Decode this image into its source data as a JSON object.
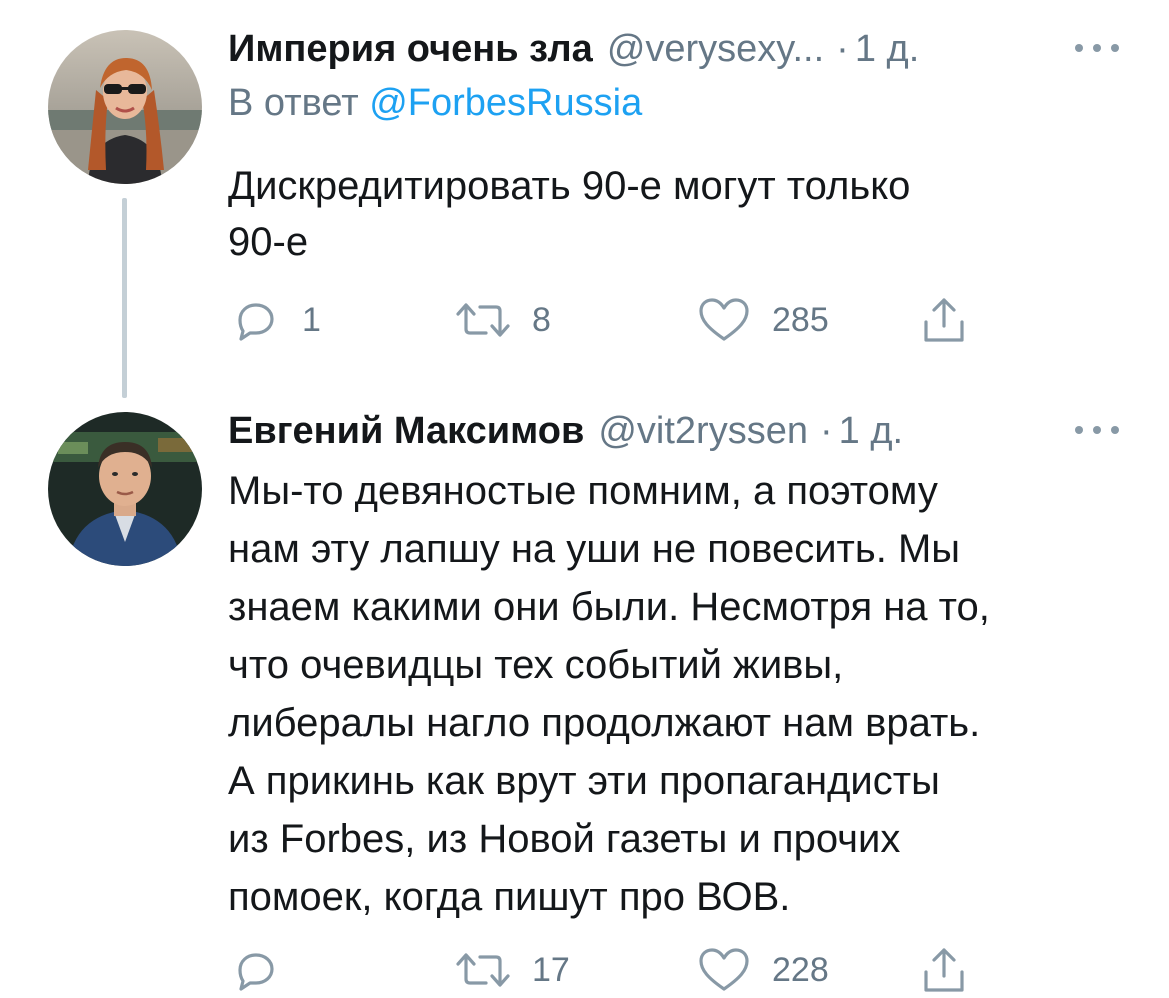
{
  "thread": [
    {
      "author": {
        "name": "Империя очень зла",
        "handle": "@verysexy...",
        "separator": "·",
        "time": "1 д."
      },
      "reply_to": {
        "prefix": "В ответ",
        "mention": "@ForbesRussia"
      },
      "text_lines": [
        "Дискредитировать 90-е могут только",
        "90-е"
      ],
      "counts": {
        "replies": "1",
        "retweets": "8",
        "likes": "285"
      },
      "icons": [
        "reply-icon",
        "retweet-icon",
        "like-icon",
        "share-icon",
        "more-icon"
      ]
    },
    {
      "author": {
        "name": "Евгений Максимов",
        "handle": "@vit2ryssen",
        "separator": "·",
        "time": "1 д."
      },
      "text_lines": [
        "Мы-то девяностые помним, а поэтому",
        "нам эту лапшу на уши не повесить. Мы",
        "знаем какими они были. Несмотря на то,",
        "что очевидцы тех событий живы,",
        "либералы нагло продолжают нам врать.",
        "А прикинь как врут эти пропагандисты",
        "из Forbes, из Новой газеты и прочих",
        "помоек, когда пишут про ВОВ."
      ],
      "counts": {
        "replies": "",
        "retweets": "17",
        "likes": "228"
      },
      "icons": [
        "reply-icon",
        "retweet-icon",
        "like-icon",
        "share-icon",
        "more-icon"
      ]
    }
  ],
  "colors": {
    "text": "#14171a",
    "secondary": "#657786",
    "link": "#1da1f2",
    "icon": "#8899a6",
    "thread_line": "#c4cfd6"
  }
}
